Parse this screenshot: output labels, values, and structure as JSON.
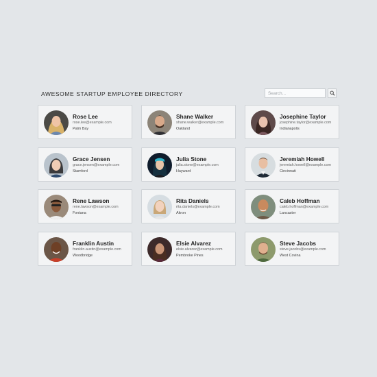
{
  "header": {
    "title": "AWESOME STARTUP EMPLOYEE DIRECTORY",
    "search_placeholder": "Search...",
    "search_icon": "magnifier-icon"
  },
  "employees": [
    {
      "name": "Rose Lee",
      "email": "rose.lee@example.com",
      "city": "Palm Bay"
    },
    {
      "name": "Shane Walker",
      "email": "shane.walker@example.com",
      "city": "Oakland"
    },
    {
      "name": "Josephine Taylor",
      "email": "josephine.taylor@example.com",
      "city": "Indianapolis"
    },
    {
      "name": "Grace Jensen",
      "email": "grace.jensen@example.com",
      "city": "Stamford"
    },
    {
      "name": "Julia Stone",
      "email": "julia.stone@example.com",
      "city": "Hayward"
    },
    {
      "name": "Jeremiah Howell",
      "email": "jeremiah.howell@example.com",
      "city": "Cincinnati"
    },
    {
      "name": "Rene Lawson",
      "email": "rene.lawson@example.com",
      "city": "Fontana"
    },
    {
      "name": "Rita Daniels",
      "email": "rita.daniels@example.com",
      "city": "Akron"
    },
    {
      "name": "Caleb Hoffman",
      "email": "caleb.hoffman@example.com",
      "city": "Lancaster"
    },
    {
      "name": "Franklin Austin",
      "email": "franklin.austin@example.com",
      "city": "Woodbridge"
    },
    {
      "name": "Elsie Alvarez",
      "email": "elsie.alvarez@example.com",
      "city": "Pembroke Pines"
    },
    {
      "name": "Steve Jacobs",
      "email": "steve.jacobs@example.com",
      "city": "West Covina"
    }
  ],
  "colors": {
    "background": "#e3e6e9",
    "card_background": "#f3f4f5",
    "card_border": "#cfd3d7"
  }
}
